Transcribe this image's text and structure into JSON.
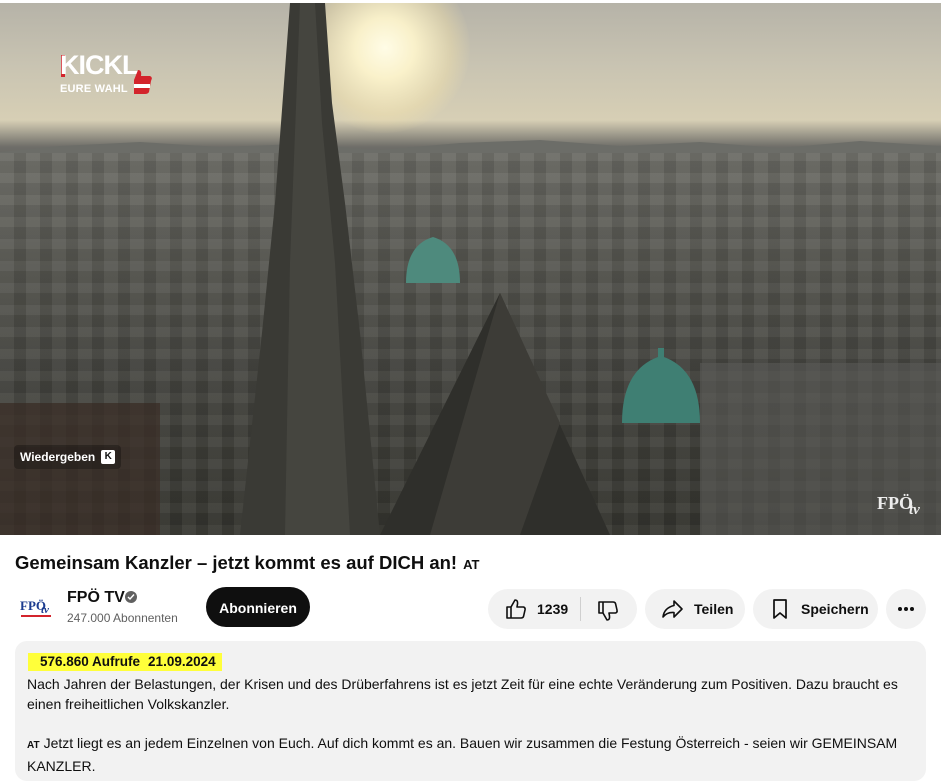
{
  "player": {
    "overlay_logo_text": "KICKL",
    "overlay_logo_sub": "EURE WAHL",
    "replay_label": "Wiedergeben",
    "replay_key": "K",
    "watermark_a": "FPÖ",
    "watermark_b": "tv"
  },
  "video": {
    "title": "Gemeinsam Kanzler – jetzt kommt es auf DICH an!",
    "country_badge": "AT"
  },
  "channel": {
    "name": "FPÖ TV",
    "avatar_a": "FPÖ",
    "avatar_b": "tv",
    "subscribers": "247.000 Abonnenten",
    "subscribe_label": "Abonnieren",
    "verified": true
  },
  "actions": {
    "like_count": "1239",
    "share_label": "Teilen",
    "save_label": "Speichern"
  },
  "description": {
    "views": "576.860 Aufrufe",
    "date": "21.09.2024",
    "paragraph1": "Nach Jahren der Belastungen, der Krisen und des Drüberfahrens ist es jetzt Zeit für eine echte Veränderung zum Positiven. Dazu braucht es einen freiheitlichen Volkskanzler.",
    "paragraph2_badge": "AT",
    "paragraph2": "Jetzt liegt es an jedem Einzelnen von Euch. Auf dich kommt es an. Bauen wir zusammen die Festung Österreich - seien wir GEMEINSAM KANZLER."
  },
  "colors": {
    "highlight": "#ffff3a",
    "subscribe_bg": "#0f0f0f",
    "pill_bg": "#f2f2f2",
    "brand_red": "#d3242c"
  }
}
